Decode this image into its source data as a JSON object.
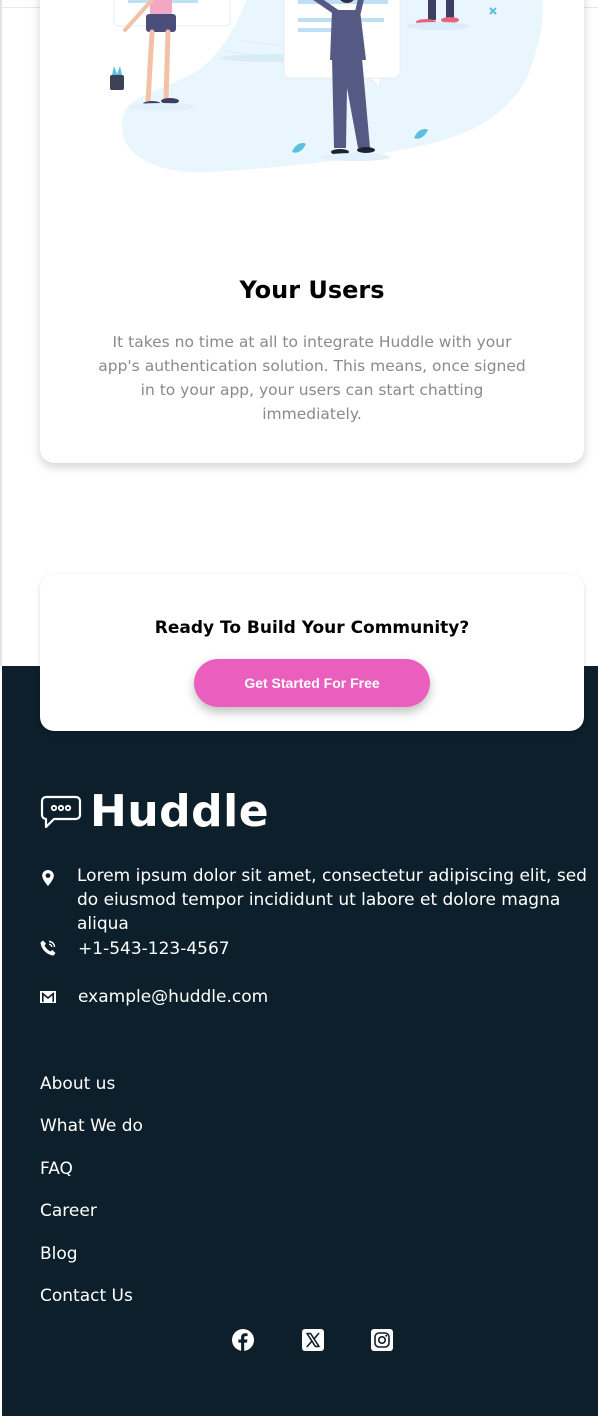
{
  "feature": {
    "title": "Your Users",
    "description": "It takes no time at all to integrate Huddle with your app's authentication solution. This means, once signed in to your app, your users can start chatting immediately."
  },
  "cta": {
    "title": "Ready To Build Your Community?",
    "button_label": "Get Started For Free",
    "button_color": "#ea5fbd"
  },
  "footer": {
    "background": "#0c1f2b",
    "logo_text": "Huddle",
    "address": "Lorem ipsum dolor sit amet, consectetur adipiscing elit, sed do eiusmod tempor incididunt ut labore et dolore magna aliqua",
    "phone": "+1-543-123-4567",
    "email": "example@huddle.com",
    "links": [
      "About us",
      "What We do",
      "FAQ",
      "Career",
      "Blog",
      "Contact Us"
    ],
    "social": [
      "facebook-icon",
      "x-icon",
      "instagram-icon"
    ]
  }
}
